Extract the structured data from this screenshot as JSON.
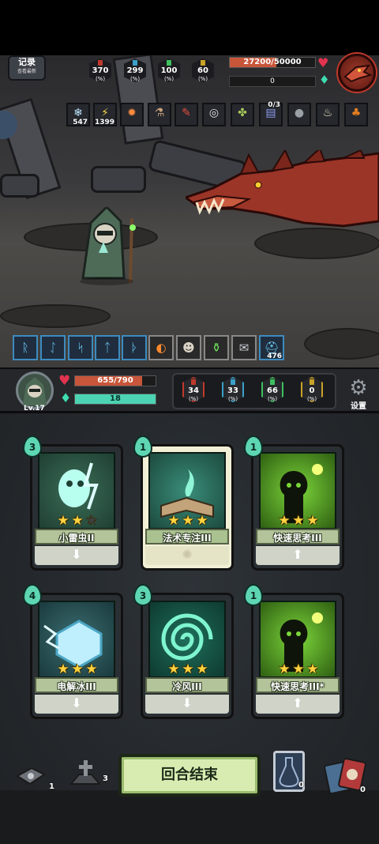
{
  "record_button": {
    "label": "记录",
    "sublabel": "查看最新"
  },
  "enemy": {
    "stats": [
      {
        "value": "370",
        "unit": "(%)",
        "color": "#c0392b"
      },
      {
        "value": "299",
        "unit": "(%)",
        "color": "#3aa0c9"
      },
      {
        "value": "100",
        "unit": "(%)",
        "color": "#3fbf5f"
      },
      {
        "value": "60",
        "unit": "(%)",
        "color": "#c9a227"
      }
    ],
    "hp_text": "27200/50000",
    "hp_fraction": 0.544,
    "shield_text": "0",
    "status_effects": [
      {
        "icon": "snowflake-icon",
        "glyph": "❄",
        "count": "547"
      },
      {
        "icon": "lightning-icon",
        "glyph": "⚡",
        "count": "1399"
      },
      {
        "icon": "fire-bomb-icon",
        "glyph": "✹",
        "count": ""
      },
      {
        "icon": "bottle-icon",
        "glyph": "⚗",
        "count": ""
      },
      {
        "icon": "chili-icon",
        "glyph": "✎",
        "count": ""
      },
      {
        "icon": "ring-icon",
        "glyph": "◎",
        "count": ""
      },
      {
        "icon": "leaf-scroll-icon",
        "glyph": "✤",
        "count": ""
      },
      {
        "icon": "book-icon",
        "glyph": "▤",
        "count": "0/3"
      },
      {
        "icon": "bomb-icon",
        "glyph": "●",
        "count": ""
      },
      {
        "icon": "cup-icon",
        "glyph": "♨",
        "count": ""
      },
      {
        "icon": "flame-apple-icon",
        "glyph": "♣",
        "count": ""
      }
    ]
  },
  "player_buffs": [
    {
      "icon": "rune-1-icon",
      "glyph": "ᚱ",
      "count": ""
    },
    {
      "icon": "rune-2-icon",
      "glyph": "ᛇ",
      "count": ""
    },
    {
      "icon": "rune-3-icon",
      "glyph": "ᛋ",
      "count": ""
    },
    {
      "icon": "rune-4-icon",
      "glyph": "ᛏ",
      "count": ""
    },
    {
      "icon": "rune-5-icon",
      "glyph": "ᚦ",
      "count": ""
    },
    {
      "icon": "fire-ring-icon",
      "glyph": "◐",
      "count": ""
    },
    {
      "icon": "mage-face-icon",
      "glyph": "☻",
      "count": ""
    },
    {
      "icon": "green-vial-icon",
      "glyph": "⚱",
      "count": ""
    },
    {
      "icon": "scroll-icon",
      "glyph": "✉",
      "count": ""
    },
    {
      "icon": "helmet-icon",
      "glyph": "⛑",
      "count": "476"
    }
  ],
  "player": {
    "level": "Lv.17",
    "hp_text": "655/790",
    "hp_fraction": 0.829,
    "energy_text": "18",
    "energy_fraction": 1.0,
    "stats": [
      {
        "value": "34",
        "unit": "(%)",
        "color": "#c0392b"
      },
      {
        "value": "33",
        "unit": "(%)",
        "color": "#3aa0c9"
      },
      {
        "value": "66",
        "unit": "(%)",
        "color": "#3fbf5f"
      },
      {
        "value": "0",
        "unit": "(%)",
        "color": "#c9a227"
      }
    ],
    "settings_label": "设置"
  },
  "cards": [
    {
      "name": "小雷虫II",
      "cost": "3",
      "stars": 2,
      "max_stars": 3,
      "art": "lightning-bug",
      "selected": false,
      "foot": "down"
    },
    {
      "name": "法术专注III",
      "cost": "1",
      "stars": 3,
      "max_stars": 3,
      "art": "spell-book",
      "selected": true,
      "foot": "swirl"
    },
    {
      "name": "快速思考III",
      "cost": "1",
      "stars": 3,
      "max_stars": 3,
      "art": "quick-think",
      "selected": false,
      "foot": "up"
    },
    {
      "name": "电解冰III",
      "cost": "4",
      "stars": 3,
      "max_stars": 3,
      "art": "ice-cube",
      "selected": false,
      "foot": "down"
    },
    {
      "name": "冷风III",
      "cost": "3",
      "stars": 3,
      "max_stars": 3,
      "art": "cold-wind",
      "selected": false,
      "foot": "down"
    },
    {
      "name": "快速思考III*",
      "cost": "1",
      "stars": 3,
      "max_stars": 3,
      "art": "quick-think",
      "selected": false,
      "foot": "up"
    }
  ],
  "bottom": {
    "deck_count": "1",
    "grave_count": "3",
    "end_turn_label": "回合结束",
    "potion_count": "0",
    "card_pile_count": "0"
  }
}
